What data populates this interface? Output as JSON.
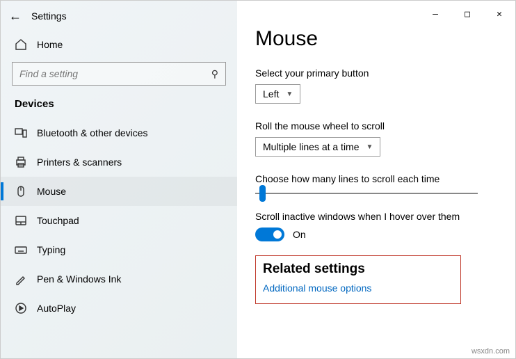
{
  "app_title": "Settings",
  "home_label": "Home",
  "search_placeholder": "Find a setting",
  "section_label": "Devices",
  "nav": [
    {
      "label": "Bluetooth & other devices"
    },
    {
      "label": "Printers & scanners"
    },
    {
      "label": "Mouse"
    },
    {
      "label": "Touchpad"
    },
    {
      "label": "Typing"
    },
    {
      "label": "Pen & Windows Ink"
    },
    {
      "label": "AutoPlay"
    }
  ],
  "page_title": "Mouse",
  "primary_button": {
    "label": "Select your primary button",
    "value": "Left"
  },
  "scroll_wheel": {
    "label": "Roll the mouse wheel to scroll",
    "value": "Multiple lines at a time"
  },
  "lines_label": "Choose how many lines to scroll each time",
  "hover": {
    "label": "Scroll inactive windows when I hover over them",
    "state": "On"
  },
  "related": {
    "title": "Related settings",
    "link": "Additional mouse options"
  },
  "watermark": "wsxdn.com"
}
